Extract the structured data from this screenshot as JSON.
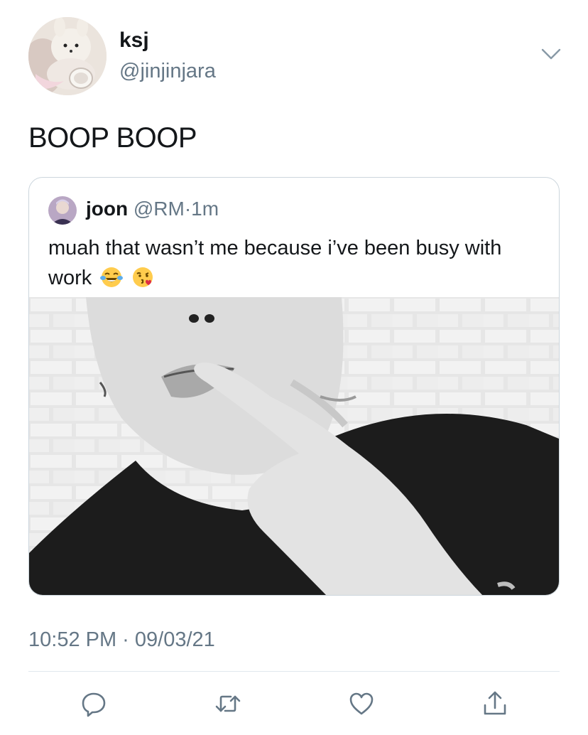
{
  "author": {
    "display_name": "ksj",
    "handle": "@jinjinjara",
    "avatar_icon": "plush-toy-avatar"
  },
  "tweet": {
    "text": "BOOP BOOP",
    "timestamp": "10:52 PM · 09/03/21"
  },
  "quoted_tweet": {
    "display_name": "joon",
    "handle": "@RM",
    "separator": "·",
    "time": "1m",
    "text": "muah that wasn’t me because i’ve been busy with work",
    "emojis": [
      "face-with-tears-of-joy",
      "face-blowing-a-kiss"
    ],
    "media": "black-and-white-photo"
  },
  "actions": {
    "reply_icon": "reply-icon",
    "retweet_icon": "retweet-icon",
    "like_icon": "heart-icon",
    "share_icon": "share-icon"
  },
  "colors": {
    "primary_text": "#14171a",
    "secondary_text": "#657786",
    "border": "#ccd6dd",
    "divider": "#e1e8ed"
  }
}
